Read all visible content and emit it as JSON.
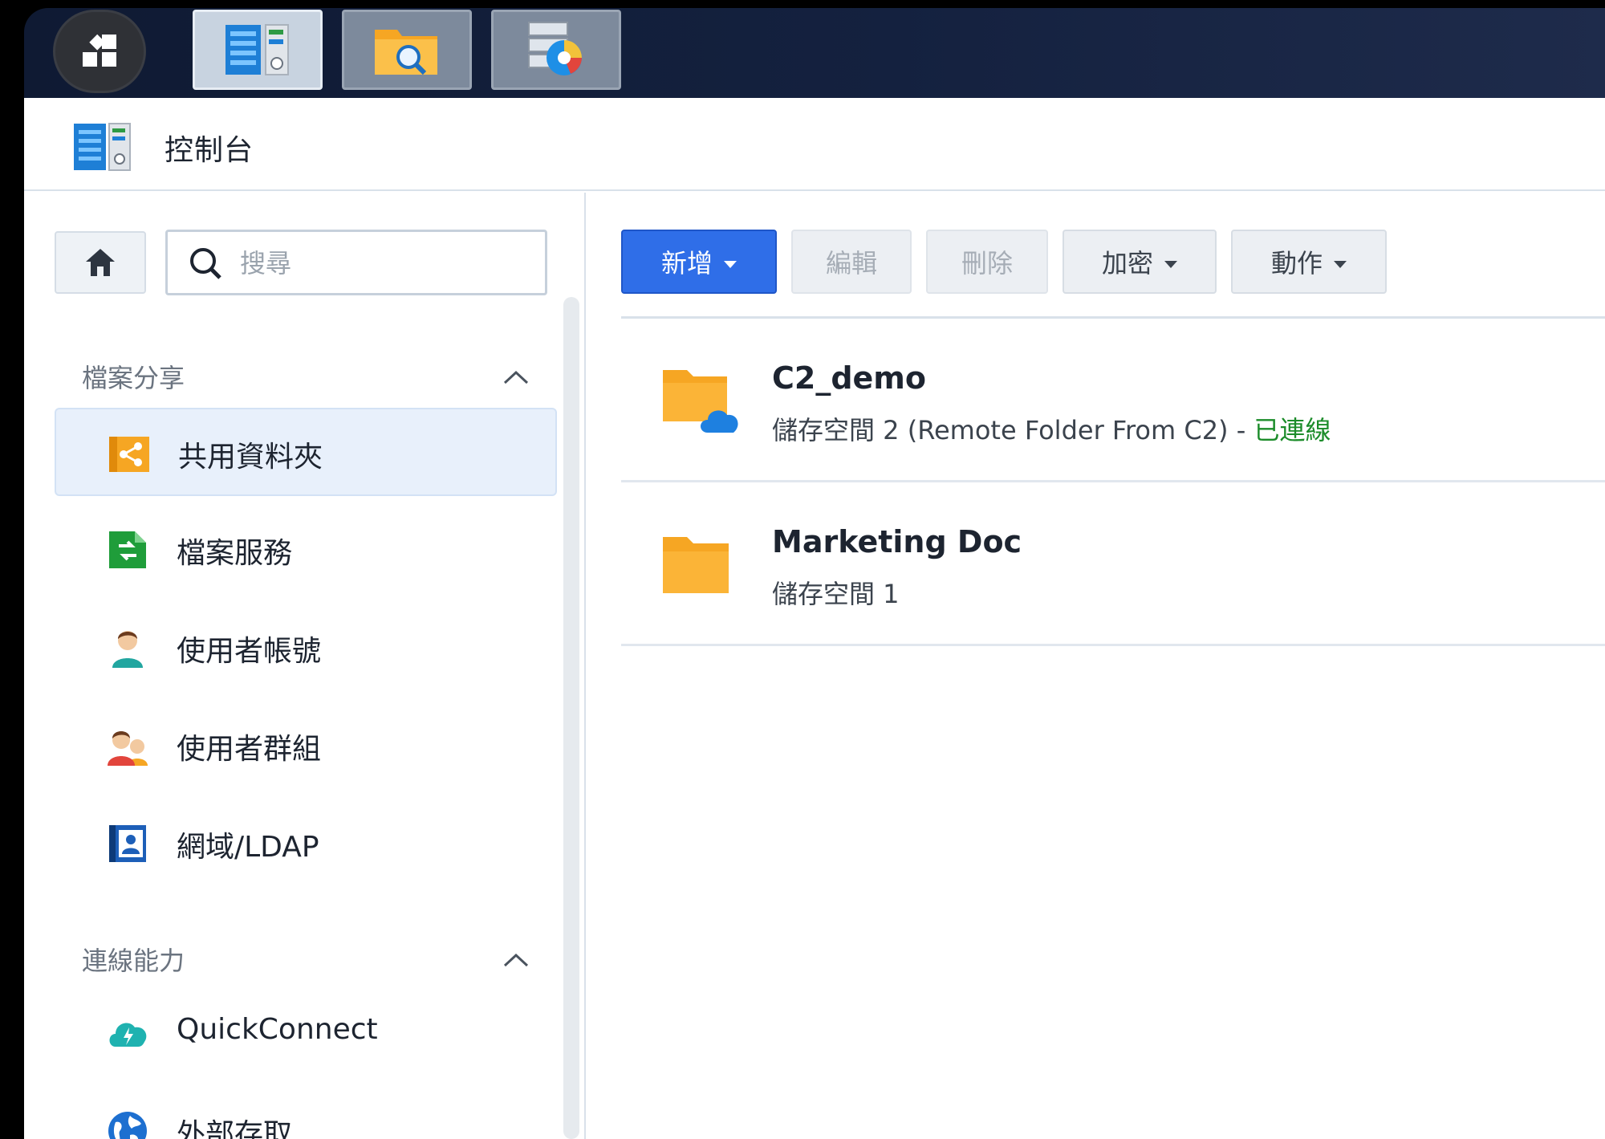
{
  "taskbar": {
    "main_menu_icon": "main-menu-grid-icon",
    "apps": [
      {
        "name": "control-panel",
        "state": "active"
      },
      {
        "name": "file-station",
        "state": "inactive"
      },
      {
        "name": "storage-manager",
        "state": "inactive"
      }
    ]
  },
  "window": {
    "title": "控制台"
  },
  "sidebar": {
    "search": {
      "placeholder": "搜尋",
      "value": ""
    },
    "sections": [
      {
        "header": "檔案分享",
        "items": [
          {
            "label": "共用資料夾",
            "icon": "shared-folder-icon",
            "selected": true
          },
          {
            "label": "檔案服務",
            "icon": "file-services-icon",
            "selected": false
          },
          {
            "label": "使用者帳號",
            "icon": "user-icon",
            "selected": false
          },
          {
            "label": "使用者群組",
            "icon": "user-group-icon",
            "selected": false
          },
          {
            "label": "網域/LDAP",
            "icon": "domain-ldap-icon",
            "selected": false
          }
        ]
      },
      {
        "header": "連線能力",
        "items": [
          {
            "label": "QuickConnect",
            "icon": "quickconnect-icon",
            "selected": false
          },
          {
            "label": "外部存取",
            "icon": "external-access-icon",
            "selected": false
          }
        ]
      }
    ]
  },
  "toolbar": {
    "create_label": "新增",
    "edit_label": "編輯",
    "delete_label": "刪除",
    "encrypt_label": "加密",
    "action_label": "動作"
  },
  "folders": [
    {
      "name": "C2_demo",
      "location": "儲存空間 2 (Remote Folder From C2) - ",
      "status": "已連線",
      "icon": "cloud-folder-icon"
    },
    {
      "name": "Marketing Doc",
      "location": "儲存空間 1",
      "status": "",
      "icon": "folder-icon"
    }
  ],
  "colors": {
    "primary_button": "#2f6ee8",
    "selected_nav": "#e8f0fb",
    "folder": "#f6a623",
    "status_connected": "#1c8c2a",
    "taskbar": "#14213f"
  }
}
